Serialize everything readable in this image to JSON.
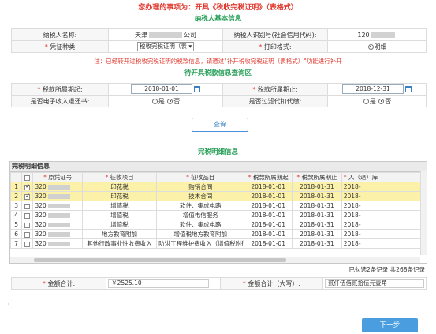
{
  "header": {
    "title": "您办理的事项为：开具《税收完税证明》（表格式）"
  },
  "taxpayer_section": {
    "title": "纳税人基本信息",
    "name_label": "纳税人名称:",
    "name_value_prefix": "天津",
    "name_value_suffix": "公司",
    "id_label": "纳税人识别号(社会信用代码):",
    "id_value_prefix": "120",
    "voucher_type_label": "凭证种类",
    "voucher_type_value": "税收完税证明（表",
    "print_format_label": "打印格式:",
    "print_format_value": "明细"
  },
  "note": "注：已经转开过税收完税证明的税款信息，请通过\"补开税收完税证明（表格式）\"功能进行补开",
  "query_section": {
    "title": "待开具税款信息查询区",
    "period_start_label": "税款所属期起:",
    "period_start_value": "2018-01-01",
    "period_end_label": "税款所属期止:",
    "period_end_value": "2018-12-31",
    "ecert_label": "是否电子收入退还书:",
    "withheld_label": "是否过滤代扣代缴:",
    "yes": "是",
    "no": "否",
    "query_button": "查询"
  },
  "detail_section": {
    "title": "完税明细信息",
    "grid_title": "完税明细信息",
    "columns": [
      "原凭证号",
      "征收项目",
      "征收品目",
      "税款所属期起",
      "税款所属期止",
      "入（退）库"
    ],
    "rows": [
      {
        "n": "1",
        "checked": true,
        "voucher": "320",
        "item": "印花税",
        "subitem": "购销合同",
        "start": "2018-01-01",
        "end": "2018-01-31",
        "extra": "2018-",
        "hl": true
      },
      {
        "n": "2",
        "checked": true,
        "voucher": "320",
        "item": "印花税",
        "subitem": "技术合同",
        "start": "2018-01-01",
        "end": "2018-01-31",
        "extra": "2018-",
        "hl": true
      },
      {
        "n": "3",
        "checked": false,
        "voucher": "320",
        "item": "增值税",
        "subitem": "软件、集成电路",
        "start": "2018-01-01",
        "end": "2018-01-31",
        "extra": "2018-",
        "hl": false
      },
      {
        "n": "4",
        "checked": false,
        "voucher": "320",
        "item": "增值税",
        "subitem": "增值电信服务",
        "start": "2018-01-01",
        "end": "2018-01-31",
        "extra": "2018-",
        "hl": false
      },
      {
        "n": "5",
        "checked": false,
        "voucher": "320",
        "item": "增值税",
        "subitem": "软件、集成电路",
        "start": "2018-01-01",
        "end": "2018-01-31",
        "extra": "2018-",
        "hl": false
      },
      {
        "n": "6",
        "checked": false,
        "voucher": "320",
        "item": "地方教育附加",
        "subitem": "增值税地方教育附加",
        "start": "2018-01-01",
        "end": "2018-01-31",
        "extra": "2018-",
        "hl": false
      },
      {
        "n": "7",
        "checked": false,
        "voucher": "320",
        "item": "其他行政事业性收费收入",
        "subitem": "防洪工程维护费收入（增值税附征）",
        "start": "2018-01-01",
        "end": "2018-01-31",
        "extra": "2018-",
        "hl": false
      }
    ],
    "summary": "已勾选2条记录,共268条记录"
  },
  "totals": {
    "amount_label": "金额合计:",
    "amount_value": "￥2525.10",
    "amount_cn_label": "金额合计（大写）:",
    "amount_cn_value": "贰仟伍佰贰拾伍元壹角"
  },
  "footer": {
    "next_button": "下一步",
    "dot": "·"
  },
  "colors": {
    "accent_red": "#e03a2f",
    "section_green": "#2aa05a",
    "button_blue": "#4a9ee0",
    "highlight_yellow": "#fbf1a9"
  }
}
